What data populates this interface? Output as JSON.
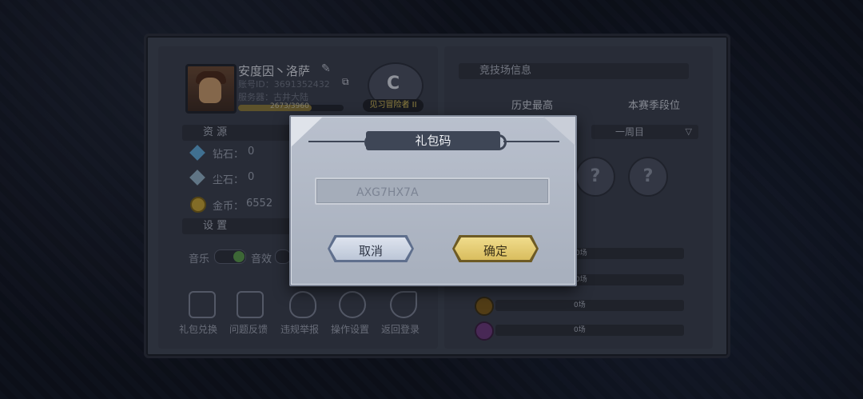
{
  "profile": {
    "name": "安度因丶洛萨",
    "account_label": "账号ID：3691352432",
    "server_label": "服务器：古井大陆",
    "xp_text": "2673/3960",
    "rank_tag": "见习冒险者 II",
    "rank_letter": "C"
  },
  "resources": {
    "header": "资 源",
    "items": [
      {
        "label": "钻石：",
        "value": "0"
      },
      {
        "label": "尘石：",
        "value": "0"
      },
      {
        "label": "金币：",
        "value": "6552"
      }
    ]
  },
  "settings": {
    "header": "设 置",
    "music_label": "音乐",
    "sfx_label": "音效"
  },
  "bottom_actions": [
    {
      "label": "礼包兑换",
      "icon": "gift-icon"
    },
    {
      "label": "问题反馈",
      "icon": "feedback-icon"
    },
    {
      "label": "违规举报",
      "icon": "report-shield-icon"
    },
    {
      "label": "操作设置",
      "icon": "gear-icon"
    },
    {
      "label": "返回登录",
      "icon": "return-icon"
    }
  ],
  "arena": {
    "header": "竞技场信息",
    "best_label": "历史最高",
    "season_label": "本赛季段位",
    "period_select": "一周目",
    "records": [
      "0场",
      "0场",
      "0场",
      "0场"
    ]
  },
  "modal": {
    "title": "礼包码",
    "code_value": "AXG7HX7A",
    "cancel_label": "取消",
    "confirm_label": "确定"
  },
  "colors": {
    "modal_bg": "#b9c0cd",
    "confirm_button": "#e4c96f",
    "cancel_button": "#cdd5e3"
  }
}
